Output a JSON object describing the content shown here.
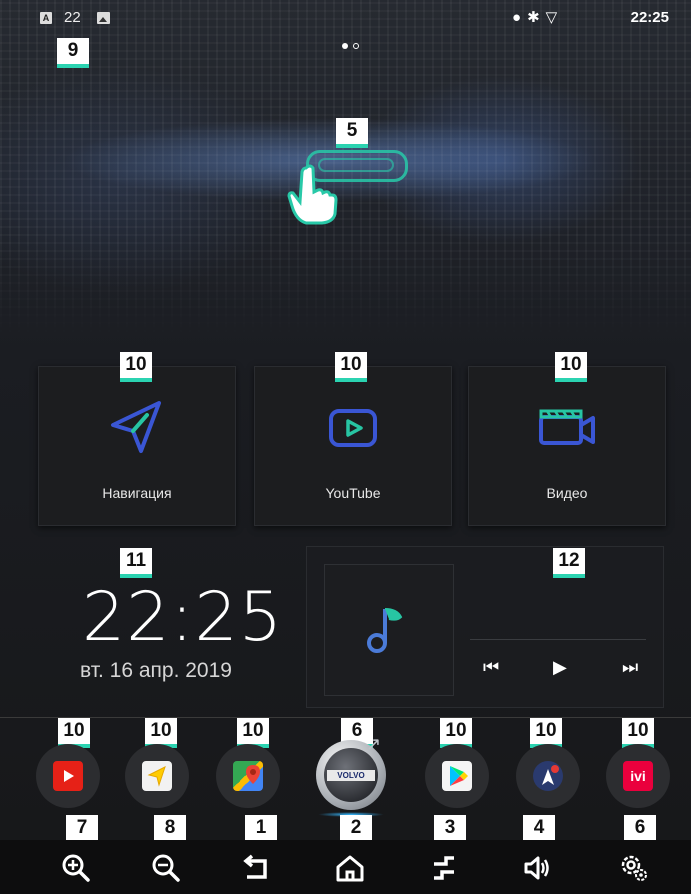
{
  "status_bar": {
    "a_badge": "A",
    "temperature": "22",
    "icons": "⬤ ✱ ▽",
    "clock": "22:25"
  },
  "badges": {
    "top_left": "9",
    "swipe": "5",
    "tile_nav": "10",
    "tile_youtube": "10",
    "tile_video": "10",
    "clock_widget": "11",
    "music_widget": "12",
    "dock": [
      "10",
      "10",
      "10",
      "6",
      "10",
      "10",
      "10"
    ],
    "nav": [
      "7",
      "8",
      "1",
      "2",
      "3",
      "4",
      "6"
    ]
  },
  "tiles": [
    {
      "label": "Навигация",
      "icon": "navigation-arrow-icon"
    },
    {
      "label": "YouTube",
      "icon": "youtube-play-icon"
    },
    {
      "label": "Видео",
      "icon": "video-camera-icon"
    }
  ],
  "clock_widget": {
    "time": "22:25",
    "date": "вт. 16 апр. 2019"
  },
  "music_widget": {
    "album_icon": "music-note-icon",
    "controls": [
      "previous",
      "play",
      "next"
    ]
  },
  "dock": [
    {
      "app": "YouTube",
      "icon": "youtube-icon",
      "color": "#e62117"
    },
    {
      "app": "Navigator",
      "icon": "yandex-navigator-icon",
      "color": "#ffd21f"
    },
    {
      "app": "Google Maps",
      "icon": "google-maps-icon",
      "color": "#34a853"
    },
    {
      "app": "Volvo",
      "icon": "volvo-logo-icon",
      "label": "VOLVO"
    },
    {
      "app": "Play Store",
      "icon": "play-store-icon",
      "color": "#01875f"
    },
    {
      "app": "Navitel",
      "icon": "navitel-icon",
      "color": "#2a3a6e"
    },
    {
      "app": "ivi",
      "icon": "ivi-icon",
      "color": "#ea003d",
      "label": "ivi"
    }
  ],
  "nav_bar": [
    {
      "name": "zoom-in",
      "icon": "zoom-in-icon",
      "glyph": "⊕"
    },
    {
      "name": "zoom-out",
      "icon": "zoom-out-icon",
      "glyph": "⊖"
    },
    {
      "name": "back",
      "icon": "back-icon",
      "glyph": "↩"
    },
    {
      "name": "home",
      "icon": "home-icon",
      "glyph": "⌂"
    },
    {
      "name": "recents",
      "icon": "recents-icon",
      "glyph": "⇌"
    },
    {
      "name": "volume",
      "icon": "volume-icon",
      "glyph": "🔈"
    },
    {
      "name": "settings",
      "icon": "settings-icon",
      "glyph": "⚙"
    }
  ],
  "colors": {
    "accent": "#2bd3b1",
    "tile_icon": "#3a56d4",
    "music_note": "#4b7bd8"
  }
}
